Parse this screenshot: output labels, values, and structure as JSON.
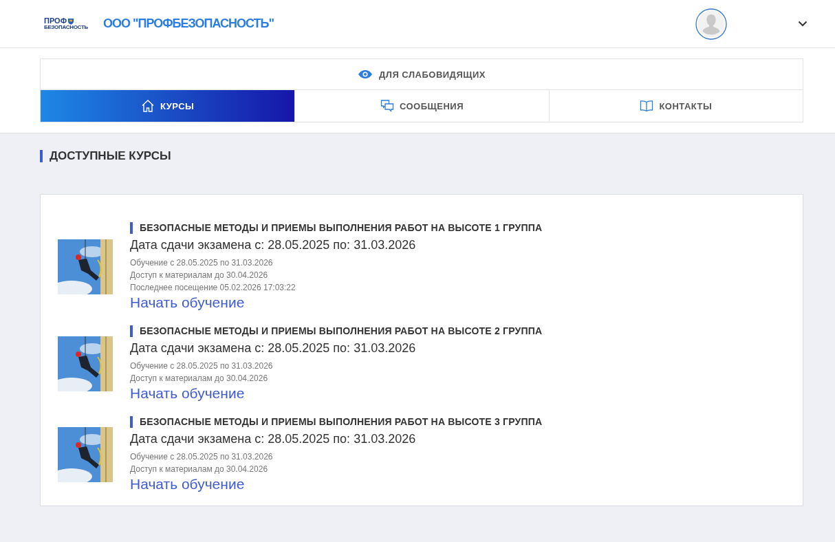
{
  "header": {
    "logo": {
      "top": "ПРОФ",
      "bottom": "БЕЗОПАСНОСТЬ"
    },
    "company": "ООО \"ПРОФБЕЗОПАСНОСТЬ\""
  },
  "accessibility": {
    "label": "ДЛЯ СЛАБОВИДЯЩИХ"
  },
  "tabs": [
    {
      "label": "КУРСЫ",
      "selected": true
    },
    {
      "label": "СООБЩЕНИЯ",
      "selected": false
    },
    {
      "label": "КОНТАКТЫ",
      "selected": false
    }
  ],
  "section_title": "ДОСТУПНЫЕ КУРСЫ",
  "courses": [
    {
      "title": "БЕЗОПАСНЫЕ МЕТОДЫ И ПРИЕМЫ ВЫПОЛНЕНИЯ РАБОТ НА ВЫСОТЕ 1 ГРУППА",
      "exam_dates": "Дата сдачи экзамена с: 28.05.2025 по: 31.03.2026",
      "details": [
        "Обучение с 28.05.2025 по 31.03.2026",
        "Доступ к материалам до 30.04.2026",
        "Последнее посещение 05.02.2026 17:03:22"
      ],
      "link": "Начать обучение"
    },
    {
      "title": "БЕЗОПАСНЫЕ МЕТОДЫ И ПРИЕМЫ ВЫПОЛНЕНИЯ РАБОТ НА ВЫСОТЕ 2 ГРУППА",
      "exam_dates": "Дата сдачи экзамена с: 28.05.2025 по: 31.03.2026",
      "details": [
        "Обучение с 28.05.2025 по 31.03.2026",
        "Доступ к материалам до 30.04.2026"
      ],
      "link": "Начать обучение"
    },
    {
      "title": "БЕЗОПАСНЫЕ МЕТОДЫ И ПРИЕМЫ ВЫПОЛНЕНИЯ РАБОТ НА ВЫСОТЕ 3 ГРУППА",
      "exam_dates": "Дата сдачи экзамена с: 28.05.2025 по: 31.03.2026",
      "details": [
        "Обучение с 28.05.2025 по 31.03.2026",
        "Доступ к материалам до 30.04.2026"
      ],
      "link": "Начать обучение"
    }
  ]
}
